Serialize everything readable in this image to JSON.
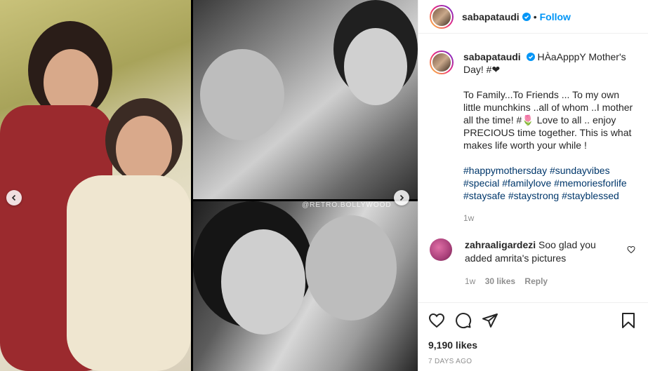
{
  "post": {
    "username": "sabapataudi",
    "follow_label": "Follow",
    "dot": "•"
  },
  "media": {
    "watermark": "@RETRO.BOLLYWOOD"
  },
  "caption": {
    "username": "sabapataudi",
    "line1": "HÀaApppY Mother's Day! #❤",
    "line2": "To Family...To Friends ... To my own little munchkins ..all of whom ..I mother all the time! #🌷 Love to all .. enjoy PRECIOUS time together. This is what makes life worth your while !",
    "hashtags": "#happymothersday #sundayvibes #special #familylove #memoriesforlife #staysafe #staystrong #stayblessed",
    "age": "1w"
  },
  "reply": {
    "username": "zahraaligardezi",
    "text": "Soo glad you added amrita's pictures",
    "age": "1w",
    "likes": "30 likes",
    "reply_label": "Reply"
  },
  "footer": {
    "likes": "9,190 likes",
    "timestamp": "7 DAYS AGO"
  },
  "icons": {
    "like": "heart-icon",
    "comment": "comment-icon",
    "share": "share-icon",
    "save": "bookmark-icon",
    "verified": "verified-badge-icon",
    "prev": "chevron-left-icon",
    "next": "chevron-right-icon"
  },
  "colors": {
    "accent": "#0095f6",
    "hashtag": "#00376b",
    "muted": "#8e8e8e"
  }
}
